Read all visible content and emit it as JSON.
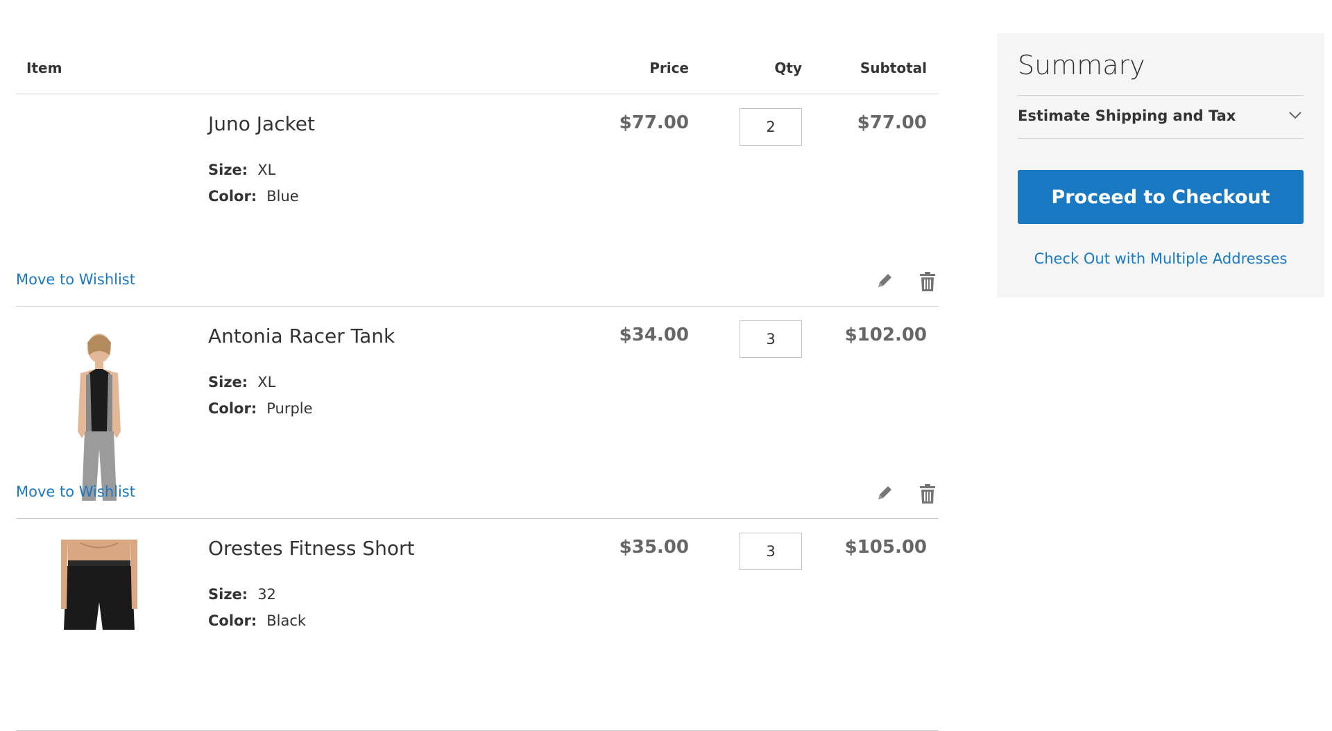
{
  "cart": {
    "headers": {
      "item": "Item",
      "price": "Price",
      "qty": "Qty",
      "subtotal": "Subtotal"
    },
    "items": [
      {
        "name": "Juno Jacket",
        "options": [
          {
            "label": "Size:",
            "value": "XL"
          },
          {
            "label": "Color:",
            "value": "Blue"
          }
        ],
        "price": "$77.00",
        "qty": "2",
        "subtotal": "$77.00",
        "wishlist": "Move to Wishlist"
      },
      {
        "name": "Antonia Racer Tank",
        "options": [
          {
            "label": "Size:",
            "value": "XL"
          },
          {
            "label": "Color:",
            "value": "Purple"
          }
        ],
        "price": "$34.00",
        "qty": "3",
        "subtotal": "$102.00",
        "wishlist": "Move to Wishlist"
      },
      {
        "name": "Orestes Fitness Short",
        "options": [
          {
            "label": "Size:",
            "value": "32"
          },
          {
            "label": "Color:",
            "value": "Black"
          }
        ],
        "price": "$35.00",
        "qty": "3",
        "subtotal": "$105.00",
        "wishlist": "Move to Wishlist"
      }
    ]
  },
  "summary": {
    "title": "Summary",
    "estimate_label": "Estimate Shipping and Tax",
    "checkout_label": "Proceed to Checkout",
    "multi_address_label": "Check Out with Multiple Addresses"
  },
  "colors": {
    "link": "#1979c3",
    "primary_button": "#1979c3",
    "summary_bg": "#f5f5f5",
    "price_text": "#666666"
  },
  "icons": {
    "edit": "pencil-icon",
    "delete": "trash-icon",
    "expand": "chevron-down-icon"
  }
}
